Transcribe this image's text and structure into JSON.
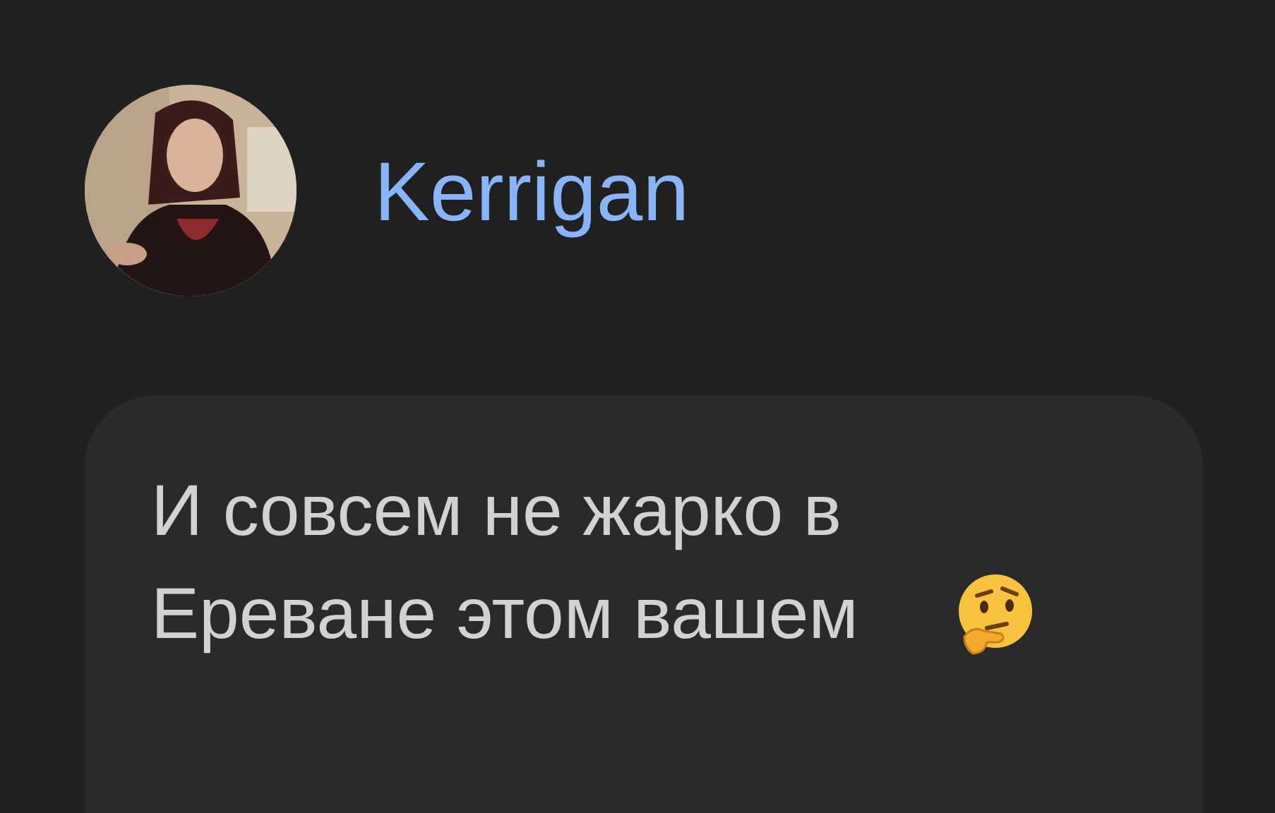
{
  "author": {
    "name": "Kerrigan"
  },
  "message": {
    "text": "И совсем не жарко в Ереване этом вашем",
    "emoji": {
      "kind": "thinking"
    }
  }
}
